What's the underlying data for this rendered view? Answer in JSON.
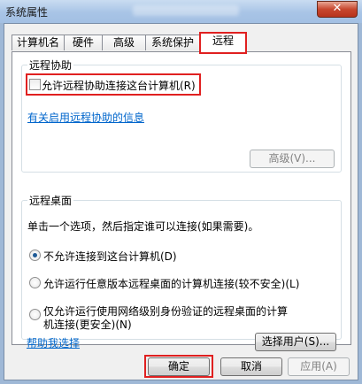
{
  "window": {
    "title": "系统属性",
    "close_glyph": "✕"
  },
  "tabs": [
    {
      "label": "计算机名"
    },
    {
      "label": "硬件"
    },
    {
      "label": "高级"
    },
    {
      "label": "系统保护"
    },
    {
      "label": "远程"
    }
  ],
  "remote_assistance": {
    "legend": "远程协助",
    "allow_label": "允许远程协助连接这台计算机(R)",
    "info_link": "有关启用远程协助的信息",
    "advanced_button": "高级(V)..."
  },
  "remote_desktop": {
    "legend": "远程桌面",
    "instruction": "单击一个选项，然后指定谁可以连接(如果需要)。",
    "options": [
      {
        "label": "不允许连接到这台计算机(D)"
      },
      {
        "label": "允许运行任意版本远程桌面的计算机连接(较不安全)(L)"
      },
      {
        "label": "仅允许运行使用网络级别身份验证的远程桌面的计算",
        "label2": "机连接(更安全)(N)"
      }
    ],
    "help_link": "帮助我选择",
    "select_users_button": "选择用户(S)..."
  },
  "footer": {
    "ok": "确定",
    "cancel": "取消",
    "apply": "应用(A)"
  }
}
